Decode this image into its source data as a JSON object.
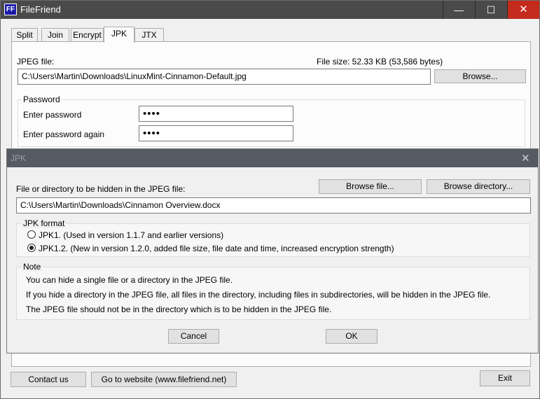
{
  "window": {
    "title": "FileFriend",
    "icon_text": "FF",
    "controls": {
      "minimize": "—",
      "maximize": "☐",
      "close": "✕"
    }
  },
  "tabs": [
    {
      "label": "Split"
    },
    {
      "label": "Join"
    },
    {
      "label": "Encrypt"
    },
    {
      "label": "JPK"
    },
    {
      "label": "JTX"
    }
  ],
  "active_tab": "JPK",
  "jpk_panel": {
    "jpeg_label": "JPEG file:",
    "file_size": "File size: 52.33 KB (53,586 bytes)",
    "jpeg_path": "C:\\Users\\Martin\\Downloads\\LinuxMint-Cinnamon-Default.jpg",
    "browse_label": "Browse...",
    "password_group": "Password",
    "enter_password_label": "Enter password",
    "enter_password_again_label": "Enter password again",
    "password_value": "••••",
    "password_again_value": "••••"
  },
  "dialog": {
    "title": "JPK",
    "close": "✕",
    "hidden_label": "File or directory to be hidden in the JPEG file:",
    "browse_file": "Browse file...",
    "browse_directory": "Browse directory...",
    "hidden_path": "C:\\Users\\Martin\\Downloads\\Cinnamon Overview.docx",
    "format_group": "JPK format",
    "formats": [
      {
        "label": "JPK1. (Used in version 1.1.7 and earlier versions)",
        "checked": false
      },
      {
        "label": "JPK1.2. (New in version 1.2.0, added file size, file date and time, increased encryption strength)",
        "checked": true
      }
    ],
    "note_group": "Note",
    "notes": [
      "You can hide a single file or a directory in the JPEG file.",
      "If you hide a directory in the JPEG file, all files in the directory, including files in subdirectories, will be hidden in the JPEG file.",
      "The JPEG file should not be in the directory which is to be hidden in the JPEG file."
    ],
    "cancel": "Cancel",
    "ok": "OK"
  },
  "footer": {
    "contact": "Contact us",
    "website": "Go to website (www.filefriend.net)",
    "exit": "Exit"
  }
}
